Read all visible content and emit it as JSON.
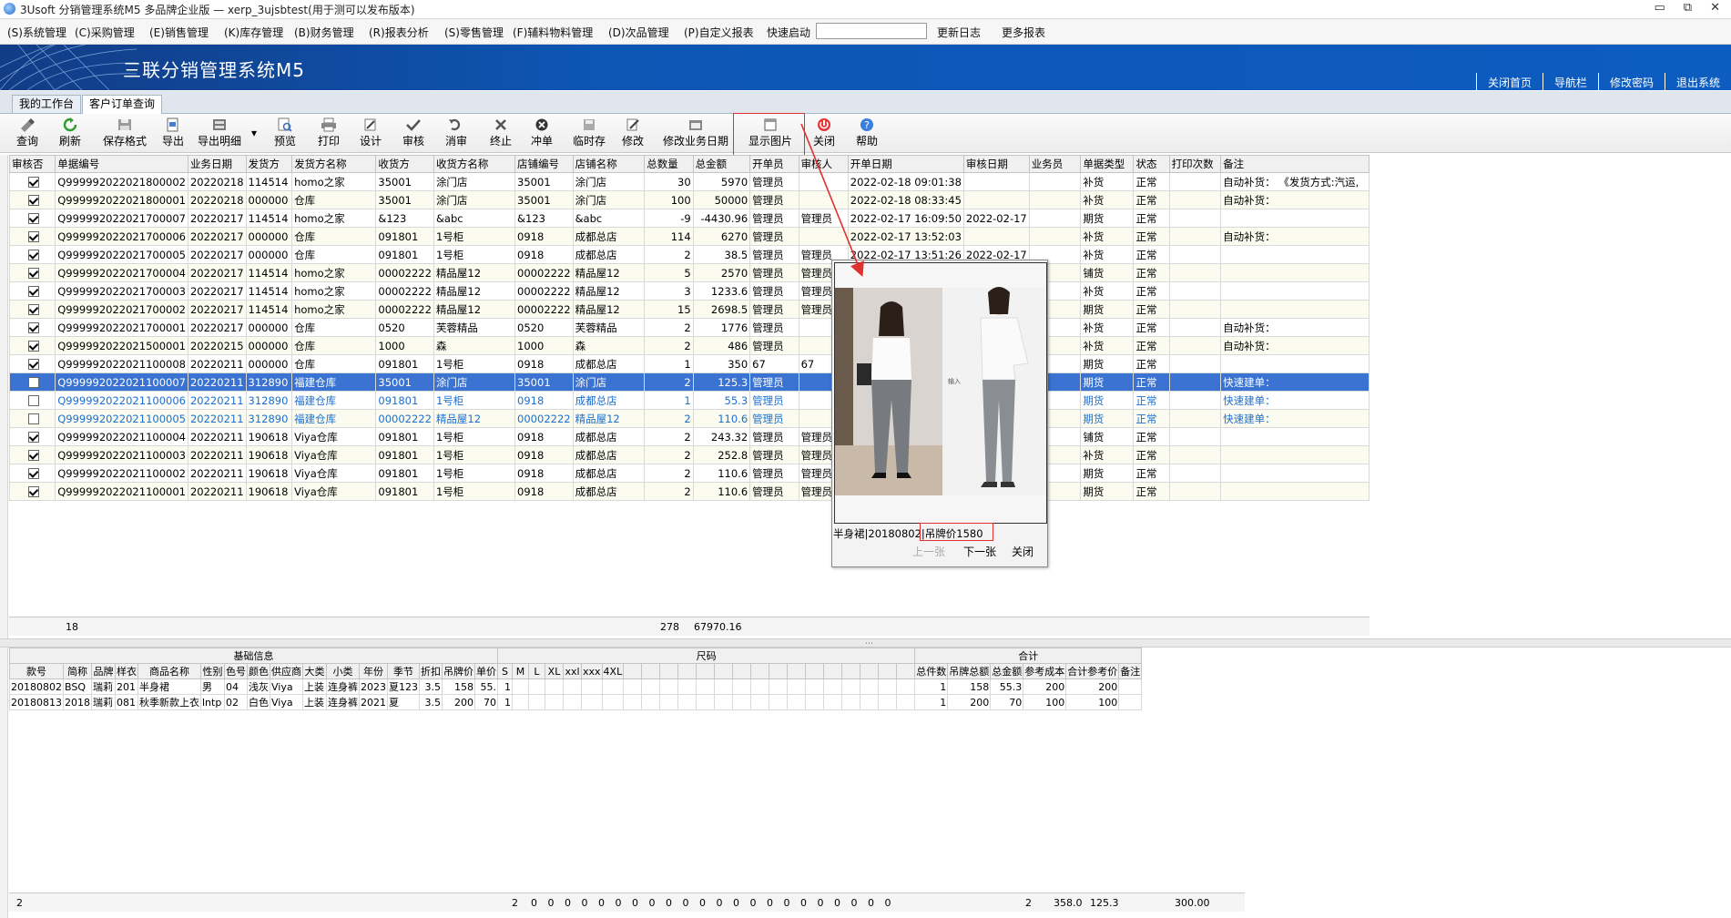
{
  "window": {
    "title": "3Usoft 分销管理系统M5 多品牌企业版 — xerp_3ujsbtest(用于测可以发布版本)",
    "controls": [
      "▭",
      "⧉",
      "✕"
    ]
  },
  "menu": {
    "items": [
      "(S)系统管理",
      "(C)采购管理",
      "(E)销售管理",
      "(K)库存管理",
      "(B)财务管理",
      "(R)报表分析",
      "(S)零售管理",
      "(F)辅料物料管理",
      "(D)次品管理",
      "(P)自定义报表"
    ],
    "quick_label": "快速启动",
    "quick_value": "",
    "changelog": "更新日志",
    "more_reports": "更多报表"
  },
  "banner": {
    "brand": "三联分销管理系统M5",
    "links": [
      "关闭首页",
      "导航栏",
      "修改密码",
      "退出系统"
    ]
  },
  "tabs": [
    "我的工作台",
    "客户订单查询"
  ],
  "toolbar": {
    "buttons": [
      "查询",
      "刷新",
      "保存格式",
      "导出",
      "导出明细",
      "预览",
      "打印",
      "设计",
      "审核",
      "消审",
      "终止",
      "冲单",
      "临时存",
      "修改",
      "修改业务日期",
      "显示图片",
      "关闭",
      "帮助"
    ],
    "dropdown_arrow": "▾"
  },
  "grid": {
    "columns": [
      "审核否",
      "单据编号",
      "业务日期",
      "发货方",
      "发货方名称",
      "收货方",
      "收货方名称",
      "店铺编号",
      "店铺名称",
      "总数量",
      "总金额",
      "开单员",
      "审核人",
      "开单日期",
      "审核日期",
      "业务员",
      "单据类型",
      "状态",
      "打印次数",
      "备注"
    ],
    "rows": [
      {
        "checked": true,
        "cells": [
          "Q999992022021800002",
          "20220218",
          "114514",
          "homo之家",
          "35001",
          "涂门店",
          "35001",
          "涂门店",
          "30",
          "5970",
          "管理员",
          "",
          "2022-02-18 09:01:38",
          "",
          "",
          "补货",
          "正常",
          "",
          "自动补货： 《发货方式:汽运,"
        ]
      },
      {
        "checked": true,
        "cells": [
          "Q999992022021800001",
          "20220218",
          "000000",
          "仓库",
          "35001",
          "涂门店",
          "35001",
          "涂门店",
          "100",
          "50000",
          "管理员",
          "",
          "2022-02-18 08:33:45",
          "",
          "",
          "补货",
          "正常",
          "",
          "自动补货："
        ]
      },
      {
        "checked": true,
        "cells": [
          "Q999992022021700007",
          "20220217",
          "114514",
          "homo之家",
          "&123",
          "&abc",
          "&123",
          "&abc",
          "-9",
          "-4430.96",
          "管理员",
          "管理员",
          "2022-02-17 16:09:50",
          "2022-02-17",
          "",
          "期货",
          "正常",
          "",
          ""
        ]
      },
      {
        "checked": true,
        "cells": [
          "Q999992022021700006",
          "20220217",
          "000000",
          "仓库",
          "091801",
          "1号柜",
          "0918",
          "成都总店",
          "114",
          "6270",
          "管理员",
          "",
          "2022-02-17 13:52:03",
          "",
          "",
          "补货",
          "正常",
          "",
          "自动补货："
        ]
      },
      {
        "checked": true,
        "cells": [
          "Q999992022021700005",
          "20220217",
          "000000",
          "仓库",
          "091801",
          "1号柜",
          "0918",
          "成都总店",
          "2",
          "38.5",
          "管理员",
          "管理员",
          "2022-02-17 13:51:26",
          "2022-02-17",
          "",
          "补货",
          "正常",
          "",
          ""
        ]
      },
      {
        "checked": true,
        "cells": [
          "Q999992022021700004",
          "20220217",
          "114514",
          "homo之家",
          "00002222",
          "精品屋12",
          "00002222",
          "精品屋12",
          "5",
          "2570",
          "管理员",
          "管理员",
          "",
          "",
          "",
          "铺货",
          "正常",
          "",
          ""
        ]
      },
      {
        "checked": true,
        "cells": [
          "Q999992022021700003",
          "20220217",
          "114514",
          "homo之家",
          "00002222",
          "精品屋12",
          "00002222",
          "精品屋12",
          "3",
          "1233.6",
          "管理员",
          "管理员",
          "",
          "",
          "",
          "补货",
          "正常",
          "",
          ""
        ]
      },
      {
        "checked": true,
        "cells": [
          "Q999992022021700002",
          "20220217",
          "114514",
          "homo之家",
          "00002222",
          "精品屋12",
          "00002222",
          "精品屋12",
          "15",
          "2698.5",
          "管理员",
          "管理员",
          "",
          "",
          "",
          "期货",
          "正常",
          "",
          ""
        ]
      },
      {
        "checked": true,
        "cells": [
          "Q999992022021700001",
          "20220217",
          "000000",
          "仓库",
          "0520",
          "芙蓉精品",
          "0520",
          "芙蓉精品",
          "2",
          "1776",
          "管理员",
          "",
          "",
          "",
          "",
          "补货",
          "正常",
          "",
          "自动补货："
        ]
      },
      {
        "checked": true,
        "cells": [
          "Q999992022021500001",
          "20220215",
          "000000",
          "仓库",
          "1000",
          "森",
          "1000",
          "森",
          "2",
          "486",
          "管理员",
          "",
          "",
          "",
          "",
          "补货",
          "正常",
          "",
          "自动补货："
        ]
      },
      {
        "checked": true,
        "cells": [
          "Q999992022021100008",
          "20220211",
          "000000",
          "仓库",
          "091801",
          "1号柜",
          "0918",
          "成都总店",
          "1",
          "350",
          "67",
          "67",
          "",
          "",
          "",
          "期货",
          "正常",
          "",
          ""
        ]
      },
      {
        "checked": false,
        "sel": true,
        "cells": [
          "Q999992022021100007",
          "20220211",
          "312890",
          "福建仓库",
          "35001",
          "涂门店",
          "35001",
          "涂门店",
          "2",
          "125.3",
          "管理员",
          "",
          "",
          "",
          "",
          "期货",
          "正常",
          "",
          "快速建单："
        ]
      },
      {
        "checked": false,
        "blue": true,
        "cells": [
          "Q999992022021100006",
          "20220211",
          "312890",
          "福建仓库",
          "091801",
          "1号柜",
          "0918",
          "成都总店",
          "1",
          "55.3",
          "管理员",
          "",
          "",
          "",
          "",
          "期货",
          "正常",
          "",
          "快速建单："
        ]
      },
      {
        "checked": false,
        "blue": true,
        "cells": [
          "Q999992022021100005",
          "20220211",
          "312890",
          "福建仓库",
          "00002222",
          "精品屋12",
          "00002222",
          "精品屋12",
          "2",
          "110.6",
          "管理员",
          "",
          "",
          "",
          "",
          "期货",
          "正常",
          "",
          "快速建单："
        ]
      },
      {
        "checked": true,
        "cells": [
          "Q999992022021100004",
          "20220211",
          "190618",
          "Viya仓库",
          "091801",
          "1号柜",
          "0918",
          "成都总店",
          "2",
          "243.32",
          "管理员",
          "管理员",
          "",
          "",
          "",
          "铺货",
          "正常",
          "",
          ""
        ]
      },
      {
        "checked": true,
        "cells": [
          "Q999992022021100003",
          "20220211",
          "190618",
          "Viya仓库",
          "091801",
          "1号柜",
          "0918",
          "成都总店",
          "2",
          "252.8",
          "管理员",
          "管理员",
          "",
          "",
          "",
          "补货",
          "正常",
          "",
          ""
        ]
      },
      {
        "checked": true,
        "cells": [
          "Q999992022021100002",
          "20220211",
          "190618",
          "Viya仓库",
          "091801",
          "1号柜",
          "0918",
          "成都总店",
          "2",
          "110.6",
          "管理员",
          "管理员",
          "",
          "",
          "",
          "期货",
          "正常",
          "",
          ""
        ]
      },
      {
        "checked": true,
        "cells": [
          "Q999992022021100001",
          "20220211",
          "190618",
          "Viya仓库",
          "091801",
          "1号柜",
          "0918",
          "成都总店",
          "2",
          "110.6",
          "管理员",
          "管理员",
          "",
          "",
          "",
          "期货",
          "正常",
          "",
          ""
        ]
      }
    ],
    "footer": {
      "count": "18",
      "total_qty": "278",
      "total_amount": "67970.16"
    }
  },
  "detail": {
    "group_headers": [
      "基础信息",
      "尺码",
      "合计"
    ],
    "columns": [
      "款号",
      "简称",
      "品牌",
      "样衣",
      "商品名称",
      "性别",
      "色号",
      "颜色",
      "供应商",
      "大类",
      "小类",
      "年份",
      "季节",
      "折扣",
      "吊牌价",
      "单价",
      "S",
      "M",
      "L",
      "XL",
      "xxl",
      "xxx",
      "4XL",
      "总件数",
      "吊牌总额",
      "总金额",
      "参考成本",
      "合计参考价",
      "备注"
    ],
    "rows": [
      [
        "20180802",
        "BSQ",
        "瑞莉",
        "201",
        "半身裙",
        "男",
        "04",
        "浅灰",
        "Viya",
        "上装",
        "连身裤",
        "2023",
        "夏123",
        "3.5",
        "158",
        "55.",
        "1",
        "",
        "",
        "",
        "",
        "",
        "",
        "1",
        "158",
        "55.3",
        "200",
        "200",
        ""
      ],
      [
        "20180813",
        "2018",
        "瑞莉",
        "081",
        "秋季新款上衣",
        "lntp",
        "02",
        "白色",
        "Viya",
        "上装",
        "连身裤",
        "2021",
        "夏",
        "3.5",
        "200",
        "70",
        "1",
        "",
        "",
        "",
        "",
        "",
        "",
        "1",
        "200",
        "70",
        "100",
        "100",
        ""
      ]
    ],
    "footer": {
      "count": "2",
      "size_total": "2",
      "zeros": "0",
      "qty": "2",
      "tag_total": "358.0",
      "amount": "125.3",
      "ref": "300.00"
    }
  },
  "popup": {
    "caption_name": "半身裙",
    "caption_code": "20180802",
    "caption_price": "吊牌价1580",
    "photo_tag": "输入",
    "prev": "上一张",
    "next": "下一张",
    "close": "关闭"
  },
  "colors": {
    "banner": "#0d56b4",
    "selection": "#3a73d1",
    "link_blue": "#1a6fd1",
    "annotation_red": "#e03030"
  }
}
